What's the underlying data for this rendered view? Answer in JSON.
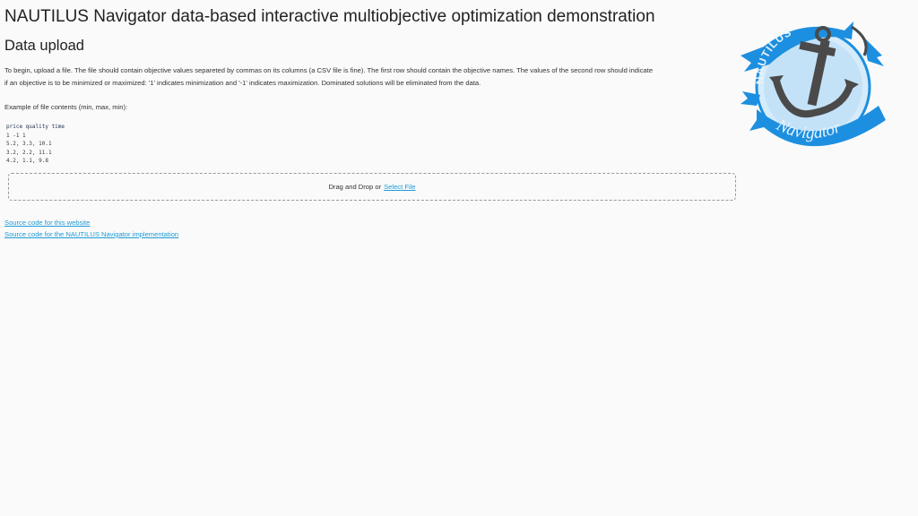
{
  "header": {
    "title": "NAUTILUS Navigator data-based interactive multiobjective optimization demonstration"
  },
  "upload_section": {
    "title": "Data upload",
    "intro_line1": "To begin, upload a file. The file should contain objective values separeted by commas on its columns (a CSV file is fine). The first row should contain the objective names. The values of the second row should indicate",
    "intro_line2": "if an objective is to be minimized or maximized: '1' indicates minimization and '-1' indicates maximization. Dominated solutions will be eliminated from the data.",
    "example_label": "Example of file contents (min, max, min):",
    "example_lines": [
      "price quality time",
      "1 -1 1",
      "5.2, 3.3, 10.1",
      "3.2, 2.2, 11.1",
      "4.2, 1.1, 9.8"
    ],
    "dropzone_text": "Drag and Drop or",
    "dropzone_link": "Select File"
  },
  "links": {
    "website_source": "Source code for this website",
    "navigator_source": "Source code for the NAUTILUS Navigator implementation"
  },
  "logo": {
    "icon": "nautilus-navigator-anchor-logo",
    "top_text": "NAUTILUS",
    "bottom_text": "Navigator",
    "colors": {
      "ribbon": "#1d8fe0",
      "circle": "#cfe8f8",
      "anchor": "#4a4a4a"
    }
  },
  "colors": {
    "link": "#1f9bd6",
    "background": "#fafafa",
    "text": "#333333"
  }
}
